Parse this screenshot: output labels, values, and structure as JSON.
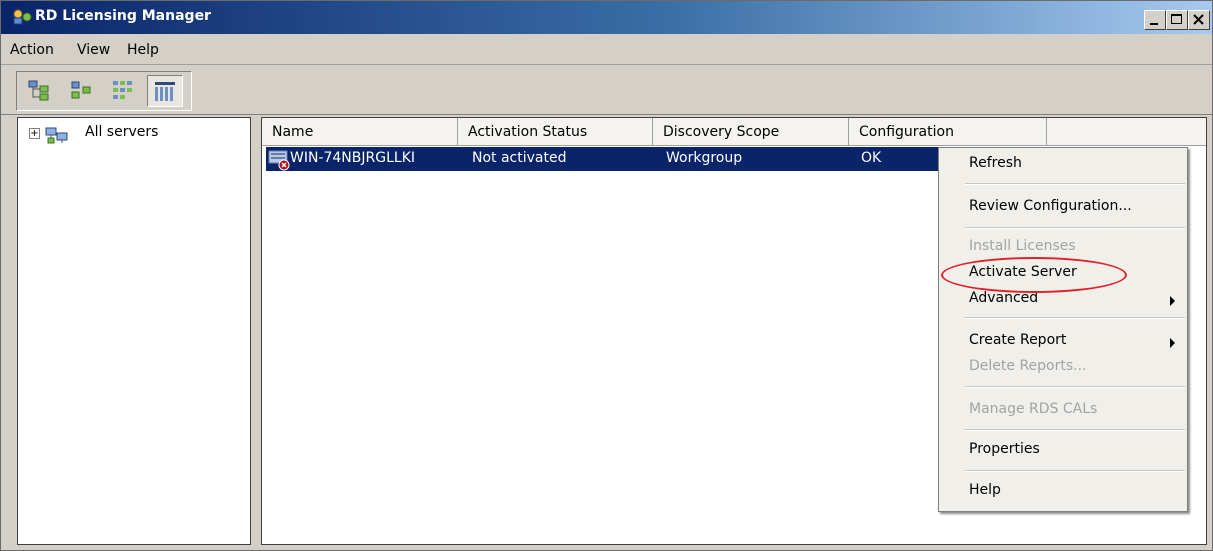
{
  "window": {
    "title": "RD Licensing Manager"
  },
  "menubar": {
    "items": [
      "Action",
      "View",
      "Help"
    ]
  },
  "toolbar": {
    "buttons": [
      "tree-view-icon",
      "large-icons-icon",
      "small-icons-icon",
      "details-view-icon"
    ]
  },
  "tree": {
    "root_label": "All servers",
    "expander": "+"
  },
  "list": {
    "columns": [
      "Name",
      "Activation Status",
      "Discovery Scope",
      "Configuration"
    ],
    "rows": [
      {
        "name": "WIN-74NBJRGLLKI",
        "activation_status": "Not activated",
        "discovery_scope": "Workgroup",
        "configuration": "OK"
      }
    ]
  },
  "context_menu": {
    "items": [
      {
        "label": "Refresh",
        "enabled": true
      },
      {
        "label": "Review Configuration...",
        "enabled": true
      },
      {
        "label": "Install Licenses",
        "enabled": false
      },
      {
        "label": "Activate Server",
        "enabled": true,
        "highlighted": true
      },
      {
        "label": "Advanced",
        "enabled": true,
        "submenu": true
      },
      {
        "label": "Create Report",
        "enabled": true,
        "submenu": true
      },
      {
        "label": "Delete Reports...",
        "enabled": false
      },
      {
        "label": "Manage RDS CALs",
        "enabled": false
      },
      {
        "label": "Properties",
        "enabled": true
      },
      {
        "label": "Help",
        "enabled": true
      }
    ]
  },
  "colors": {
    "selection": "#0a246a",
    "highlight_ring": "#e0202a",
    "disabled_text": "#a3a3a3"
  }
}
